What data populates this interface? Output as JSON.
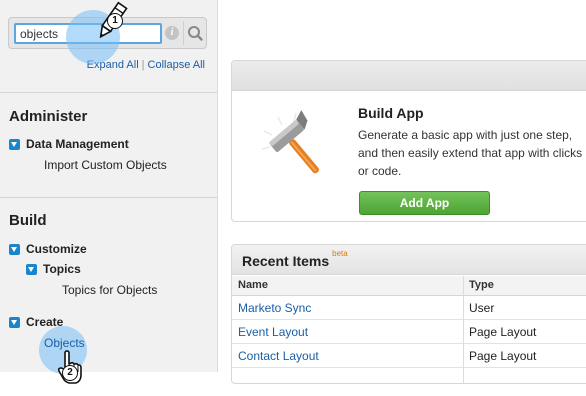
{
  "sidebar": {
    "search": {
      "value": "objects",
      "info_icon": "info-icon",
      "search_icon": "magnifier-icon"
    },
    "links": {
      "expand_all": "Expand All",
      "separator": "|",
      "collapse_all": "Collapse All"
    },
    "administer": {
      "title": "Administer",
      "data_management": "Data Management",
      "import_custom_objects": "Import Custom Objects"
    },
    "build": {
      "title": "Build",
      "customize": "Customize",
      "topics": "Topics",
      "topics_for_objects": "Topics for Objects",
      "create": "Create",
      "objects": "Objects"
    }
  },
  "build_app": {
    "title": "Build App",
    "description": "Generate a basic app with just one step, and then easily extend that app with clicks or code.",
    "button": "Add App"
  },
  "recent_items": {
    "title": "Recent Items",
    "beta": "beta",
    "columns": [
      "Name",
      "Type"
    ],
    "rows": [
      {
        "name": "Marketo Sync",
        "type": "User"
      },
      {
        "name": "Event Layout",
        "type": "Page Layout"
      },
      {
        "name": "Contact Layout",
        "type": "Page Layout"
      }
    ]
  },
  "annotations": {
    "step1": "1",
    "step2": "2"
  },
  "colors": {
    "accent_blue": "#1a86c9",
    "link": "#1a5fa8",
    "button_green": "#4ea433",
    "highlight": "#78bef5"
  }
}
